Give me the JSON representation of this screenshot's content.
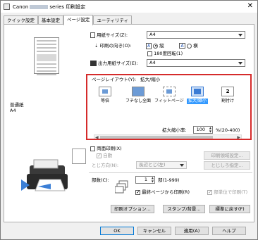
{
  "window": {
    "title_prefix": "Canon",
    "title_suffix": "series 印刷設定",
    "close_glyph": "✕"
  },
  "tabs": [
    "クイック設定",
    "基本設定",
    "ページ設定",
    "ユーティリティ"
  ],
  "active_tab_index": 2,
  "preview": {
    "media_line1": "普通紙",
    "media_line2": "A4"
  },
  "page_size": {
    "label": "用紙サイズ(Z):",
    "value": "A4"
  },
  "orientation": {
    "label": "印刷の向き(O):",
    "portrait": "縦",
    "landscape": "横",
    "selected": "portrait",
    "rotate_label": "180度回転(1)"
  },
  "output_size": {
    "label": "出力用紙サイズ(E):",
    "value": "A4"
  },
  "page_layout": {
    "label": "ページレイアウト(Y):",
    "current": "拡大/縮小",
    "items": [
      {
        "label": "等倍",
        "icon": "normal-size-icon"
      },
      {
        "label": "フチなし全面",
        "icon": "borderless-icon"
      },
      {
        "label": "フィットページ",
        "icon": "fit-to-page-icon"
      },
      {
        "label": "拡大/縮小",
        "icon": "scaled-icon",
        "selected": true
      },
      {
        "label": "割付け",
        "icon": "page-layout-icon",
        "badge": "2"
      }
    ],
    "scale_label": "拡大縮小率:",
    "scale_value": "100",
    "scale_range": "%(20-400)"
  },
  "duplex": {
    "label": "両面印刷(X)",
    "auto_label": "自動",
    "area_button": "印刷領域設定...",
    "side_label": "とじ方向(N):",
    "side_value": "長辺とじ(左)",
    "margin_button": "とじしろ指定..."
  },
  "copies": {
    "label": "部数(C):",
    "value": "1",
    "range": "部(1-999)",
    "last_first_label": "最終ページから印刷(R)",
    "collate_label": "部単位で印刷(T)"
  },
  "lower_buttons": [
    "印刷オプション...",
    "スタンプ/背景...",
    "標準に戻す(F)"
  ],
  "dialog_buttons": [
    "OK",
    "キャンセル",
    "適用(A)",
    "ヘルプ"
  ]
}
